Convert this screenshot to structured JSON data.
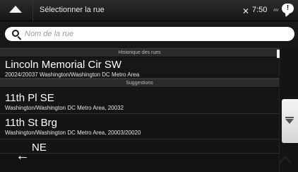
{
  "header": {
    "title": "Sélectionner la rue",
    "time": "7:50",
    "time_suffix": "AM",
    "notification_glyph": "!",
    "back_icon": "up-arrow-icon",
    "gps_icon": "satellite-icon"
  },
  "search": {
    "placeholder": "Nom de la rue",
    "value": ""
  },
  "list": {
    "history_header": "Historique des rues",
    "suggestions_header": "Suggestions",
    "history_items": [
      {
        "name": "Lincoln Memorial Cir SW",
        "detail": "20024/20037 Washington/Washington DC Metro Area"
      }
    ],
    "suggestion_items": [
      {
        "name": "11th Pl SE",
        "detail": "Washington/Washington DC Metro Area, 20032"
      },
      {
        "name": "11th St Brg",
        "detail": "Washington/Washington DC Metro Area, 20003/20020"
      },
      {
        "name": "NE",
        "detail": ""
      }
    ]
  },
  "footer": {
    "back_glyph": "←"
  },
  "colors": {
    "background": "#121212",
    "text": "#ffffff",
    "search_field": "#ffffff",
    "scroll_button": "#e6e6e6"
  }
}
